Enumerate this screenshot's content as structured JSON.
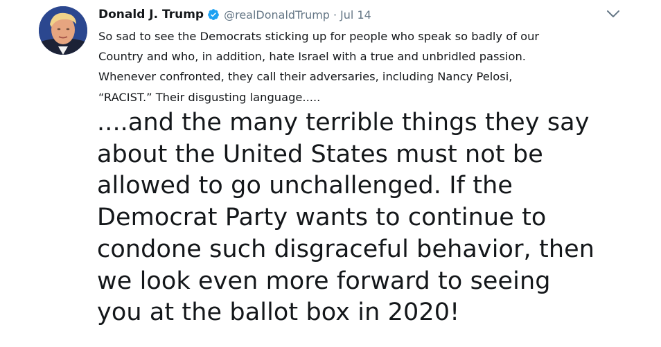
{
  "tweet": {
    "display_name": "Donald J. Trump",
    "handle": "@realDonaldTrump",
    "separator": "·",
    "date": "Jul 14",
    "quoted_text": "So sad to see the Democrats sticking up for people who speak so badly of our\nCountry and who, in addition, hate Israel with a true and unbridled passion.\nWhenever confronted, they call their adversaries, including Nancy Pelosi,\n“RACIST.” Their disgusting language.....",
    "main_text": "....and the many terrible things they say\nabout the United States must not be\nallowed to go unchallenged. If the\nDemocrat Party wants to continue to\ncondone such disgraceful behavior, then\nwe look even more forward to seeing\nyou at the ballot box in 2020!",
    "icons": {
      "verified": "verified-badge-icon",
      "caret": "chevron-down-icon",
      "avatar": "profile-photo"
    }
  },
  "colors": {
    "text": "#14171a",
    "secondary": "#657786",
    "verified": "#1da1f2"
  }
}
